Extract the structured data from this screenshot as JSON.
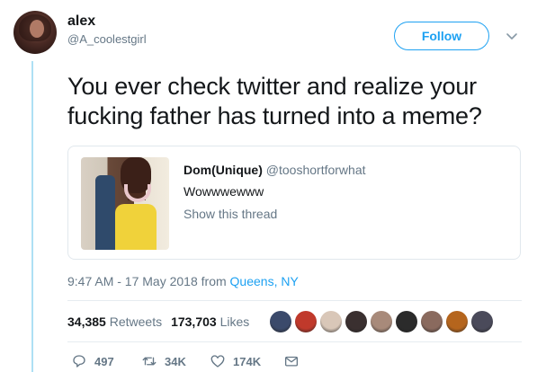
{
  "tweet": {
    "author": {
      "display_name": "alex",
      "handle": "@A_coolestgirl"
    },
    "follow_label": "Follow",
    "text": "You ever check twitter and realize your fucking father has turned into a meme?",
    "quoted": {
      "display_name": "Dom(Unique)",
      "handle": "@tooshortforwhat",
      "text": "Wowwwewww",
      "show_thread": "Show this thread"
    },
    "timestamp": "9:47 AM - 17 May 2018 from",
    "location": "Queens, NY",
    "stats": {
      "retweets_count": "34,385",
      "retweets_label": "Retweets",
      "likes_count": "173,703",
      "likes_label": "Likes"
    },
    "liker_colors": [
      "#3b4a6b",
      "#c0392b",
      "#d9c7b8",
      "#3a3030",
      "#a88a7a",
      "#2b2b2b",
      "#8a6a5e",
      "#b5651d",
      "#4a4a5a"
    ],
    "actions": {
      "reply_count": "497",
      "retweet_count": "34K",
      "like_count": "174K"
    }
  },
  "colors": {
    "accent": "#1da1f2",
    "secondary_text": "#657786",
    "thread_line": "#aee0f4"
  }
}
